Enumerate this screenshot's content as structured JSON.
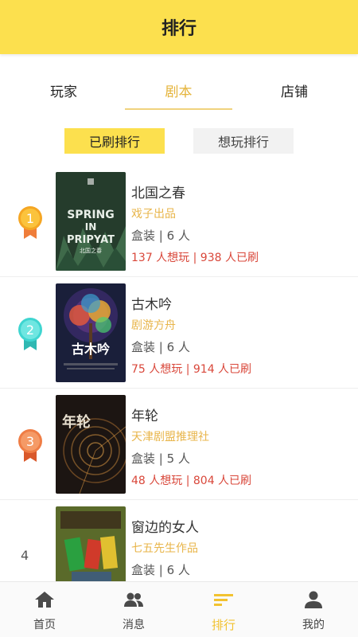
{
  "header": {
    "title": "排行"
  },
  "tabs": [
    {
      "label": "玩家"
    },
    {
      "label": "剧本"
    },
    {
      "label": "店铺"
    }
  ],
  "subtabs": [
    {
      "label": "已刷排行"
    },
    {
      "label": "想玩排行"
    }
  ],
  "list": [
    {
      "rank": "1",
      "title": "北国之春",
      "publisher": "戏子出品",
      "meta": "盒装 | 6 人",
      "stats": "137 人想玩 | 938 人已刷",
      "cover_text": "SPRING IN PRIPYAT",
      "cover_sub": "北国之春"
    },
    {
      "rank": "2",
      "title": "古木吟",
      "publisher": "剧游方舟",
      "meta": "盒装 | 6 人",
      "stats": "75 人想玩 | 914 人已刷",
      "cover_text": "古木吟"
    },
    {
      "rank": "3",
      "title": "年轮",
      "publisher": "天津剧盟推理社",
      "meta": "盒装 | 5 人",
      "stats": "48 人想玩 | 804 人已刷",
      "cover_text": "年轮"
    },
    {
      "rank": "4",
      "title": "窗边的女人",
      "publisher": "七五先生作品",
      "meta": "盒装 | 6 人",
      "stats": ""
    }
  ],
  "bottom_nav": [
    {
      "label": "首页",
      "icon": "home-icon"
    },
    {
      "label": "消息",
      "icon": "people-icon"
    },
    {
      "label": "排行",
      "icon": "ranking-icon"
    },
    {
      "label": "我的",
      "icon": "user-icon"
    }
  ],
  "colors": {
    "accent": "#fce04e",
    "publisher": "#e8b54a",
    "stats": "#d9473a",
    "rank1": "#f5a623",
    "rank2": "#3fd5d0",
    "rank3": "#ef7d45"
  }
}
